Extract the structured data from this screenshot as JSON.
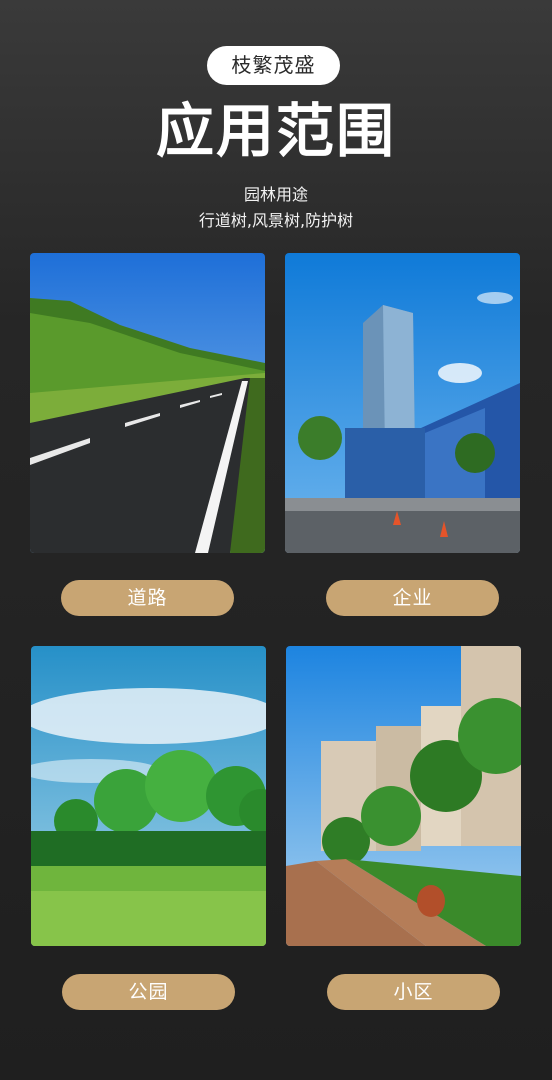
{
  "header": {
    "badge": "枝繁茂盛",
    "title": "应用范围",
    "subtitle_line1": "园林用途",
    "subtitle_line2": "行道树,风景树,防护树"
  },
  "gallery": [
    {
      "label": "道路",
      "image": "roadside-trees-photo"
    },
    {
      "label": "企业",
      "image": "office-building-photo"
    },
    {
      "label": "公园",
      "image": "park-trees-photo"
    },
    {
      "label": "小区",
      "image": "residential-street-photo"
    }
  ]
}
